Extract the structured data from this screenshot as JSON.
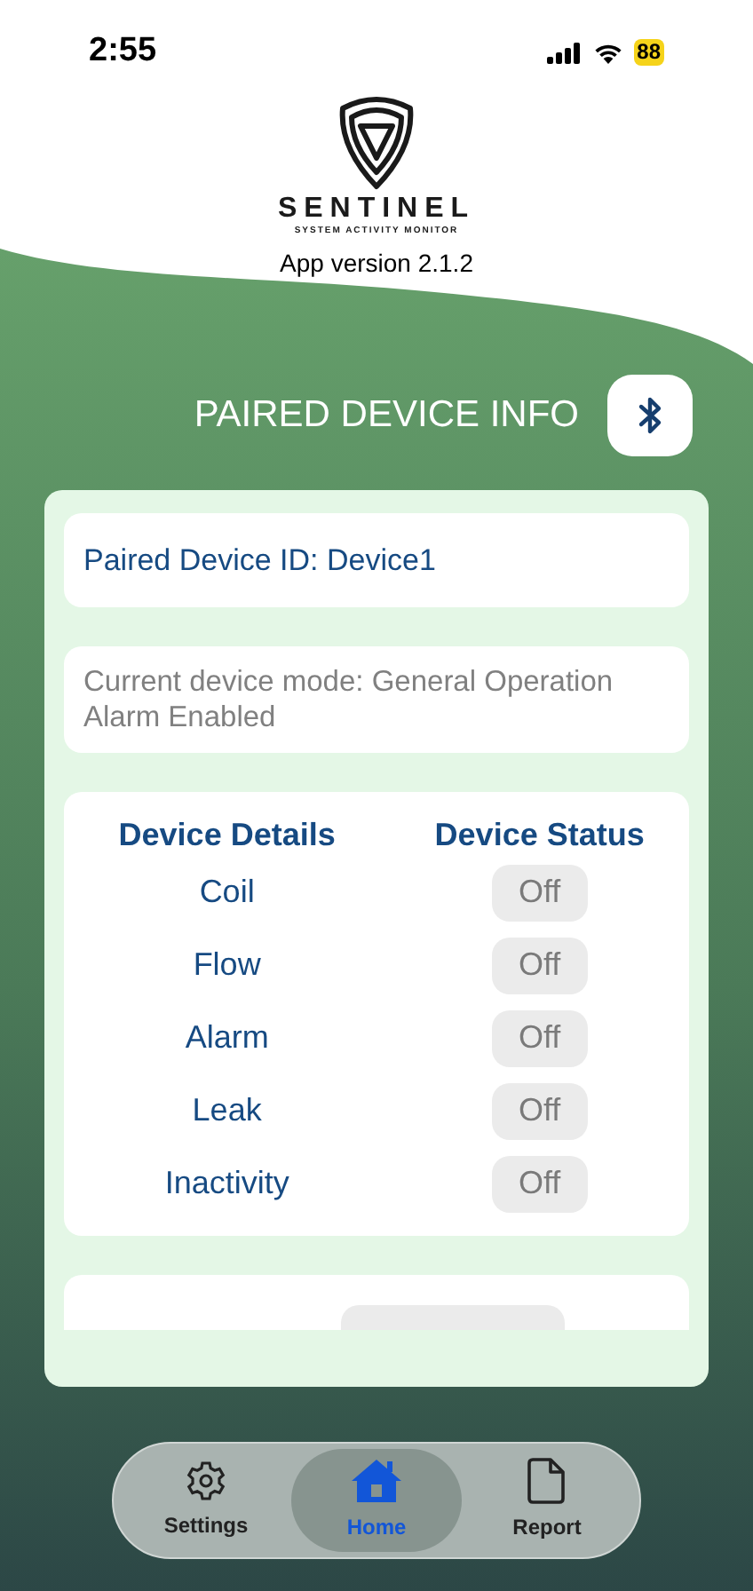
{
  "status_bar": {
    "time": "2:55",
    "battery": "88"
  },
  "header": {
    "brand": "SENTINEL",
    "tagline": "SYSTEM ACTIVITY MONITOR",
    "app_version": "App version 2.1.2"
  },
  "section_title": "PAIRED DEVICE INFO",
  "paired_device": "Paired Device ID: Device1",
  "device_mode": {
    "line_1": "Current device mode: General Operation",
    "line_2": "Alarm Enabled"
  },
  "details_table": {
    "columns": [
      "Device Details",
      "Device Status"
    ],
    "rows": [
      {
        "name": "Coil",
        "status": "Off"
      },
      {
        "name": "Flow",
        "status": "Off"
      },
      {
        "name": "Alarm",
        "status": "Off"
      },
      {
        "name": "Leak",
        "status": "Off"
      },
      {
        "name": "Inactivity",
        "status": "Off"
      }
    ]
  },
  "tab_bar": [
    {
      "kind": "settings",
      "label": "Settings",
      "selected": false
    },
    {
      "kind": "home",
      "label": "Home",
      "selected": true
    },
    {
      "kind": "report",
      "label": "Report",
      "selected": false
    }
  ]
}
